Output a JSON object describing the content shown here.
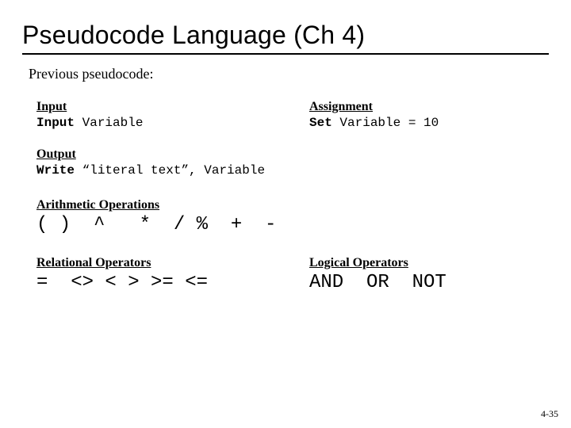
{
  "title": "Pseudocode Language (Ch 4)",
  "subtitle": "Previous pseudocode:",
  "input": {
    "head": "Input",
    "kw": "Input",
    "rest": " Variable"
  },
  "assignment": {
    "head": "Assignment",
    "kw": "Set",
    "rest": " Variable = 10"
  },
  "output": {
    "head": "Output",
    "kw": "Write",
    "rest": " “literal text”, Variable"
  },
  "arith": {
    "head": "Arithmetic Operations",
    "ops": "( )  ^   *  / %  +  -"
  },
  "relational": {
    "head": "Relational Operators",
    "ops": "=  <> < > >= <="
  },
  "logical": {
    "head": "Logical Operators",
    "ops": "AND  OR  NOT"
  },
  "slidenum": "4-35"
}
